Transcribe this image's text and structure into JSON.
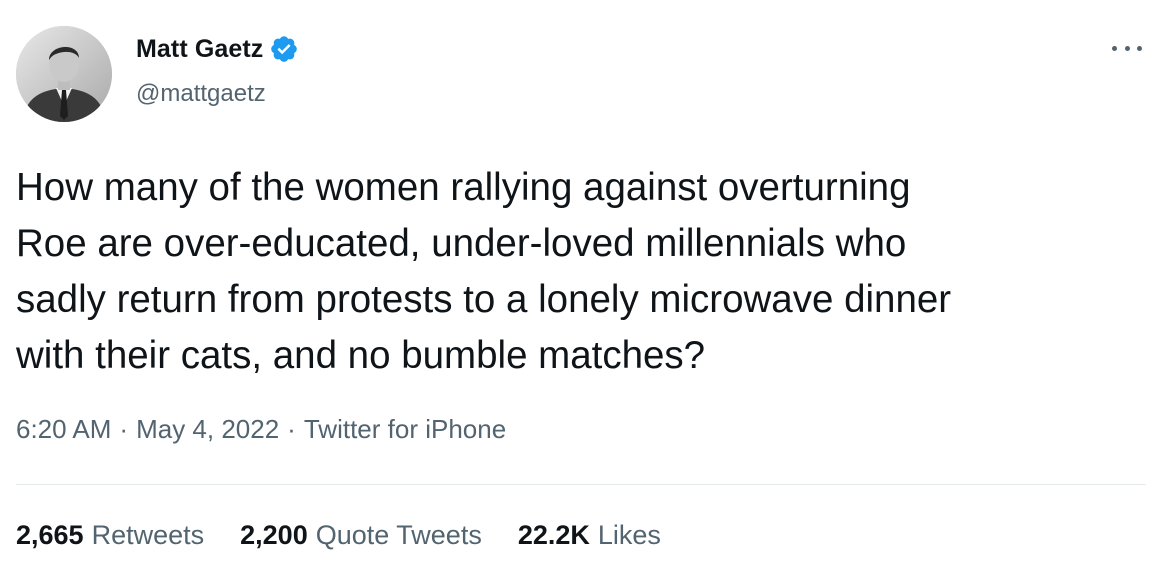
{
  "author": {
    "display_name": "Matt Gaetz",
    "handle": "@mattgaetz",
    "verified": true
  },
  "tweet": {
    "text": "How many of the women rallying against overturning\nRoe are over-educated, under-loved millennials who\nsadly return from protests to a lonely microwave dinner\nwith their cats, and no bumble matches?",
    "time": "6:20 AM",
    "separator": "·",
    "date": "May 4, 2022",
    "source": "Twitter for iPhone"
  },
  "stats": {
    "retweets": {
      "count": "2,665",
      "label": "Retweets"
    },
    "quote_tweets": {
      "count": "2,200",
      "label": "Quote Tweets"
    },
    "likes": {
      "count": "22.2K",
      "label": "Likes"
    }
  },
  "colors": {
    "text_primary": "#0f1419",
    "text_secondary": "#536471",
    "verified_blue": "#1d9bf0",
    "divider": "#e4e9ec"
  },
  "icons": {
    "verified": "verified-badge-icon",
    "more": "more-options-icon"
  }
}
